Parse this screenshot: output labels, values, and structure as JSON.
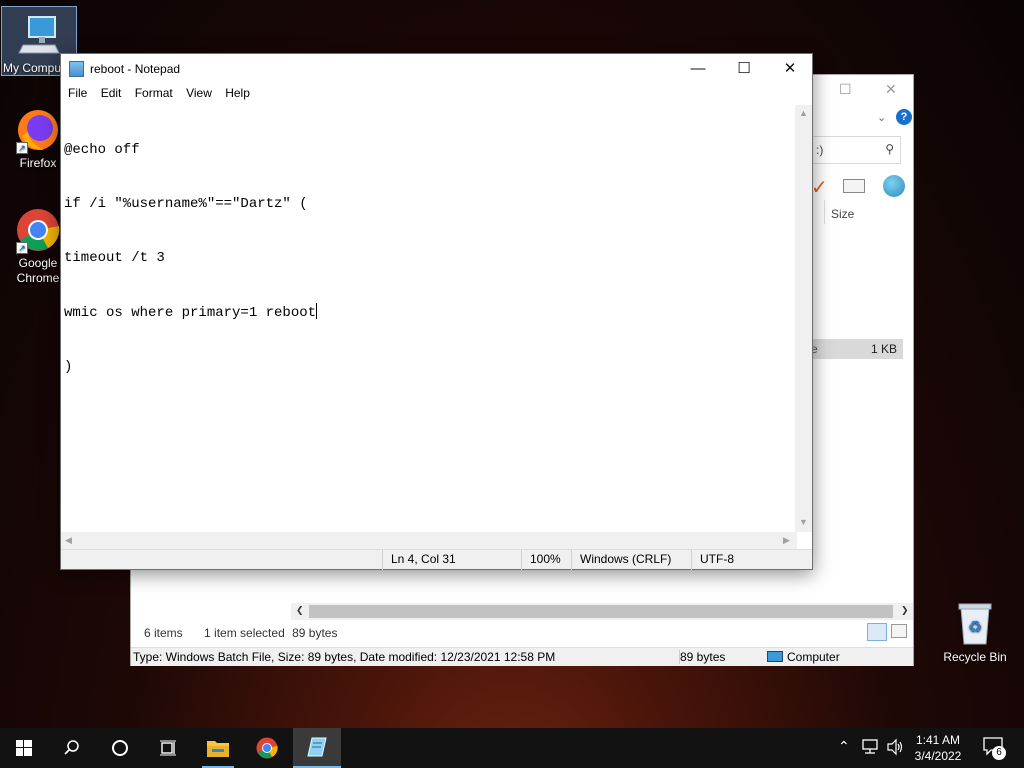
{
  "desktop": {
    "icons": [
      {
        "label": "My Computer",
        "name": "my-computer"
      },
      {
        "label": "Firefox",
        "name": "firefox"
      },
      {
        "label": "Google Chrome",
        "name": "google-chrome"
      },
      {
        "label": "Recycle Bin",
        "name": "recycle-bin"
      }
    ]
  },
  "explorer": {
    "search_text": ":)",
    "column_size": "Size",
    "selected_row_tail": "e",
    "selected_row_size": "1 KB",
    "status": {
      "items": "6 items",
      "selected": "1 item selected",
      "bytes": "89 bytes"
    },
    "details": {
      "text": "Type: Windows Batch File, Size: 89 bytes, Date modified: 12/23/2021 12:58 PM",
      "size": "89 bytes",
      "location": "Computer"
    }
  },
  "notepad": {
    "title": "reboot - Notepad",
    "menu": [
      "File",
      "Edit",
      "Format",
      "View",
      "Help"
    ],
    "lines": [
      "@echo off",
      "if /i \"%username%\"==\"Dartz\" (",
      "timeout /t 3",
      "wmic os where primary=1 reboot",
      ")"
    ],
    "status": {
      "position": "Ln 4, Col 31",
      "zoom": "100%",
      "line_ending": "Windows (CRLF)",
      "encoding": "UTF-8"
    }
  },
  "taskbar": {
    "clock_time": "1:41 AM",
    "clock_date": "3/4/2022",
    "notification_count": "6"
  },
  "colors": {
    "taskbar": "#121212",
    "accent": "#76b9ed",
    "chrome_gray": "#f0f0f0"
  }
}
